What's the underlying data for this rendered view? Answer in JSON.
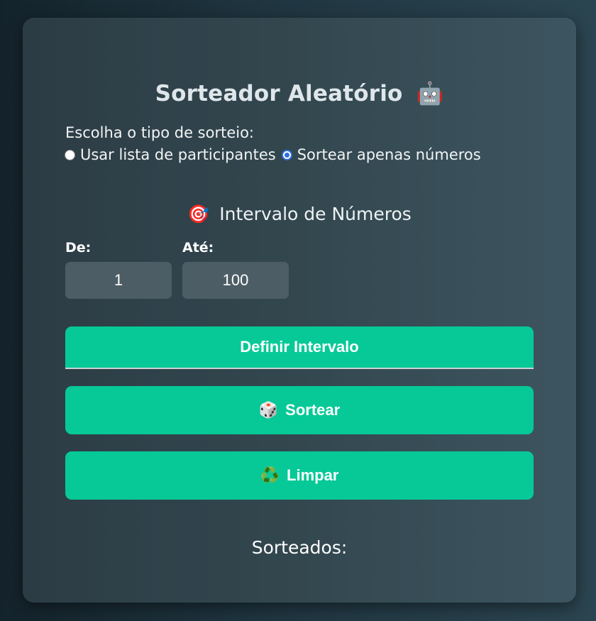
{
  "app": {
    "title": "Sorteador Aleatório",
    "title_icon": "🤖"
  },
  "draw_type": {
    "label": "Escolha o tipo de sorteio:",
    "options": [
      {
        "label": "Usar lista de participantes",
        "selected": false
      },
      {
        "label": "Sortear apenas números",
        "selected": true
      }
    ]
  },
  "range": {
    "section_icon": "🎯",
    "section_title": "Intervalo de Números",
    "from_label": "De:",
    "from_value": "1",
    "to_label": "Até:",
    "to_value": "100"
  },
  "buttons": {
    "define_label": "Definir Intervalo",
    "draw_icon": "🎲",
    "draw_label": "Sortear",
    "clear_icon": "♻️",
    "clear_label": "Limpar"
  },
  "results": {
    "label": "Sorteados:"
  },
  "colors": {
    "accent": "#06c997",
    "radio_selected": "#2f6fde",
    "input_bg": "#4d5d65"
  }
}
